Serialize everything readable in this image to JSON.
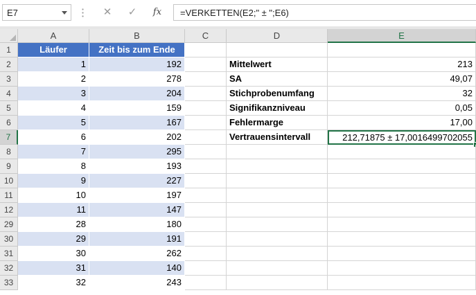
{
  "formula_bar": {
    "name_box": "E7",
    "formula": "=VERKETTEN(E2;\" ± \";E6)",
    "cancel_icon": "✕",
    "enter_icon": "✓",
    "fx_label": "fx"
  },
  "columns": [
    "A",
    "B",
    "C",
    "D",
    "E"
  ],
  "rows": [
    "1",
    "2",
    "3",
    "4",
    "5",
    "6",
    "7",
    "8",
    "9",
    "10",
    "11",
    "12",
    "29",
    "30",
    "31",
    "32",
    "33"
  ],
  "table": {
    "header": [
      "Läufer",
      "Zeit bis zum Ende"
    ],
    "runners": [
      "1",
      "2",
      "3",
      "4",
      "5",
      "6",
      "7",
      "8",
      "9",
      "10",
      "11",
      "28",
      "29",
      "30",
      "31",
      "32"
    ],
    "times": [
      "192",
      "278",
      "204",
      "159",
      "167",
      "202",
      "295",
      "193",
      "227",
      "197",
      "147",
      "180",
      "191",
      "262",
      "140",
      "243"
    ]
  },
  "stats": {
    "labels": [
      "Mittelwert",
      "SA",
      "Stichprobenumfang",
      "Signifikanzniveau",
      "Fehlermarge",
      "Vertrauensintervall"
    ],
    "values": [
      "213",
      "49,07",
      "32",
      "0,05",
      "17,00",
      "212,71875 ± 17,0016499702055"
    ]
  },
  "selection": {
    "cell": "E7",
    "accent": "#217346"
  },
  "colors": {
    "table_header": "#4472c4",
    "band": "#d9e1f2"
  }
}
